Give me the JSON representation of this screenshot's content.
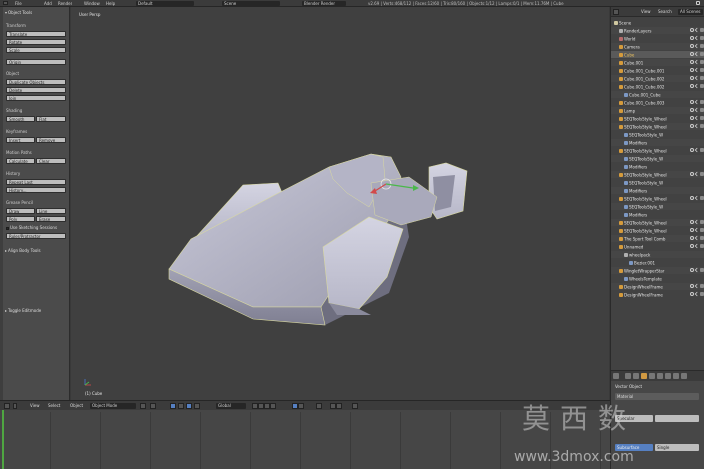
{
  "header": {
    "menus": [
      "File",
      "Add",
      "Render",
      "Window",
      "Help"
    ],
    "screen_layout": "Default",
    "scene": "Scene",
    "render_engine": "Blender Render",
    "stats": "v2.69 | Verts:468/112 | Faces:12/60 | Tris:80/160 | Objects:1/12 | Lamps:0/1 | Mem:11.76M | Cube"
  },
  "toolshelf": {
    "panel_title": "Object Tools",
    "sections": {
      "transform": "Transform",
      "object": "Object",
      "shading": "Shading",
      "keyframes": "Keyframes",
      "relations": "Relations",
      "motion_paths": "Motion Paths",
      "history": "History",
      "physics": "Grease Pencil"
    },
    "buttons": {
      "translate": "Translate",
      "rotate": "Rotate",
      "scale": "Scale",
      "origin": "Origin",
      "duplicate_objects": "Duplicate Objects",
      "delete": "Delete",
      "join": "Join",
      "smooth": "Smooth",
      "flat": "Flat",
      "insert": "Insert",
      "remove": "Remove",
      "calculate": "Calculate",
      "clear": "Clear",
      "repeat_last": "Repeat Last",
      "history": "History...",
      "draw": "Draw",
      "line": "Line",
      "poly": "Poly",
      "erase": "Erase",
      "use_sketching": "Use Sketching Sessions",
      "ruler_protractor": "Ruler/Protractor"
    },
    "collapsed_panels": {
      "align_body": "Align Body Tools",
      "toggle_subsurf": "Toggle Editmode"
    }
  },
  "viewport": {
    "view_label": "User Persp",
    "active_object": "(1) Cube"
  },
  "viewport_header": {
    "menus": [
      "View",
      "Select",
      "Object"
    ],
    "mode": "Object Mode",
    "pivot": "Global"
  },
  "outliner": {
    "tabs": [
      "View",
      "Search",
      "All Scenes"
    ],
    "items": [
      {
        "label": "Scene",
        "icon_color": "#d0c8a0",
        "indent": 0,
        "selected": false
      },
      {
        "label": "RenderLayers",
        "icon_color": "#b0b0b0",
        "indent": 1,
        "selected": false
      },
      {
        "label": "World",
        "icon_color": "#b96a6a",
        "indent": 1,
        "selected": false
      },
      {
        "label": "Camera",
        "icon_color": "#d59b3c",
        "indent": 1,
        "selected": false
      },
      {
        "label": "Cube",
        "icon_color": "#d59b3c",
        "indent": 1,
        "selected": true
      },
      {
        "label": "Cube.001",
        "icon_color": "#d59b3c",
        "indent": 1,
        "selected": false
      },
      {
        "label": "Cube.001_Cube.001",
        "icon_color": "#d59b3c",
        "indent": 1,
        "selected": false
      },
      {
        "label": "Cube.001_Cube.002",
        "icon_color": "#d59b3c",
        "indent": 1,
        "selected": false
      },
      {
        "label": "Cube.001_Cube.002",
        "icon_color": "#d59b3c",
        "indent": 1,
        "selected": false
      },
      {
        "label": "Cube.001_Cube",
        "icon_color": "#7c98c4",
        "indent": 2,
        "selected": false
      },
      {
        "label": "Cube.001_Cube.003",
        "icon_color": "#d59b3c",
        "indent": 1,
        "selected": false
      },
      {
        "label": "Lamp",
        "icon_color": "#d59b3c",
        "indent": 1,
        "selected": false
      },
      {
        "label": "SEQToolsStyle_Wheel",
        "icon_color": "#d59b3c",
        "indent": 1,
        "selected": false
      },
      {
        "label": "SEQToolsStyle_Wheel",
        "icon_color": "#d59b3c",
        "indent": 1,
        "selected": false
      },
      {
        "label": "SEQToolsStyle_W",
        "icon_color": "#7c98c4",
        "indent": 2,
        "selected": false
      },
      {
        "label": "Modifiers",
        "icon_color": "#7c98c4",
        "indent": 2,
        "selected": false
      },
      {
        "label": "SEQToolsStyle_Wheel",
        "icon_color": "#d59b3c",
        "indent": 1,
        "selected": false
      },
      {
        "label": "SEQToolsStyle_W",
        "icon_color": "#7c98c4",
        "indent": 2,
        "selected": false
      },
      {
        "label": "Modifiers",
        "icon_color": "#7c98c4",
        "indent": 2,
        "selected": false
      },
      {
        "label": "SEQToolsStyle_Wheel",
        "icon_color": "#d59b3c",
        "indent": 1,
        "selected": false
      },
      {
        "label": "SEQToolsStyle_W",
        "icon_color": "#7c98c4",
        "indent": 2,
        "selected": false
      },
      {
        "label": "Modifiers",
        "icon_color": "#7c98c4",
        "indent": 2,
        "selected": false
      },
      {
        "label": "SEQToolsStyle_Wheel",
        "icon_color": "#d59b3c",
        "indent": 1,
        "selected": false
      },
      {
        "label": "SEQToolsStyle_W",
        "icon_color": "#7c98c4",
        "indent": 2,
        "selected": false
      },
      {
        "label": "Modifiers",
        "icon_color": "#7c98c4",
        "indent": 2,
        "selected": false
      },
      {
        "label": "SEQToolsStyle_Wheel",
        "icon_color": "#d59b3c",
        "indent": 1,
        "selected": false
      },
      {
        "label": "SEQToolsStyle_Wheel",
        "icon_color": "#d59b3c",
        "indent": 1,
        "selected": false
      },
      {
        "label": "The Sport Tool Comb",
        "icon_color": "#d59b3c",
        "indent": 1,
        "selected": false
      },
      {
        "label": "Unnamed",
        "icon_color": "#d59b3c",
        "indent": 1,
        "selected": false
      },
      {
        "label": "wheelpack",
        "icon_color": "#b0b0b0",
        "indent": 2,
        "selected": false
      },
      {
        "label": "Bezier.001",
        "icon_color": "#7c98c4",
        "indent": 3,
        "selected": false
      },
      {
        "label": "WingletWrapperStar",
        "icon_color": "#d59b3c",
        "indent": 1,
        "selected": false
      },
      {
        "label": "WheelsTemplate",
        "icon_color": "#7c98c4",
        "indent": 2,
        "selected": false
      },
      {
        "label": "DesignWheelFrame",
        "icon_color": "#d59b3c",
        "indent": 1,
        "selected": false
      },
      {
        "label": "DesignWheelFrame",
        "icon_color": "#d59b3c",
        "indent": 1,
        "selected": false
      }
    ]
  },
  "properties": {
    "object_name": "Vector Object",
    "fields": {
      "f1": "Material",
      "f2": "Specular",
      "f3": "Subsurface",
      "f4": "Single"
    }
  },
  "watermark": {
    "cjk": "莫西数",
    "url": "www.3dmox.com"
  }
}
